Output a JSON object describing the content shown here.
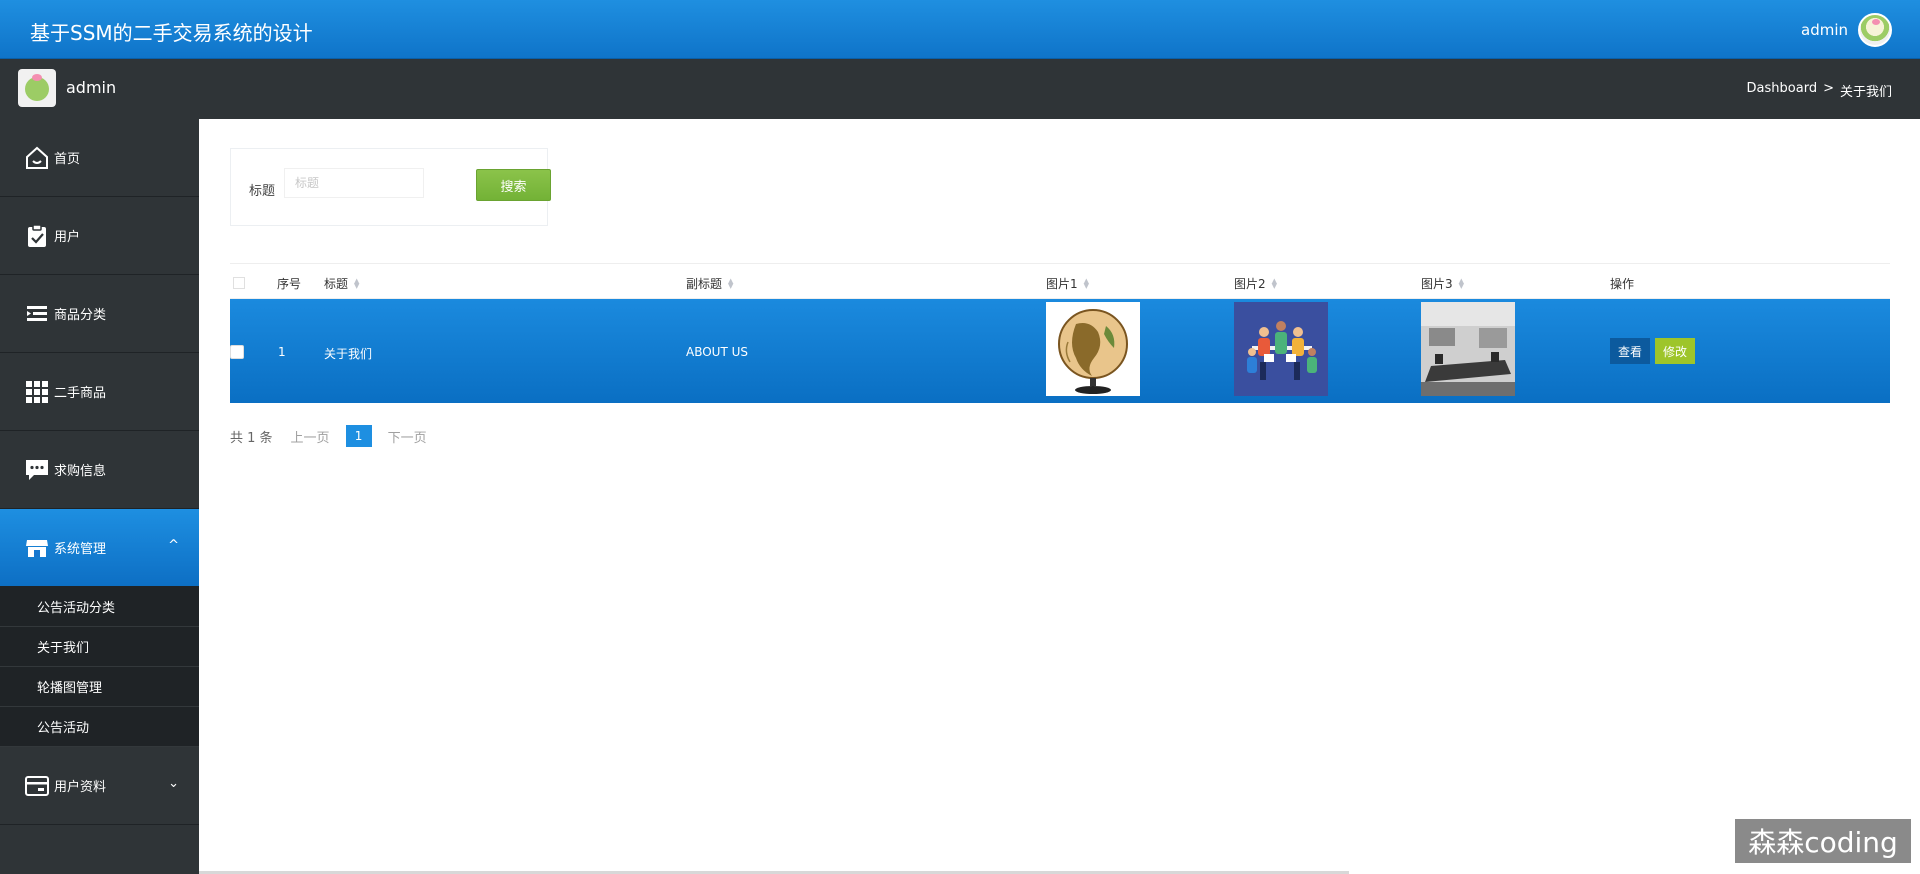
{
  "header": {
    "app_title": "基于SSM的二手交易系统的设计",
    "user_name": "admin"
  },
  "subbar": {
    "admin_name": "admin",
    "breadcrumb": [
      "Dashboard",
      ">",
      "关于我们"
    ]
  },
  "sidebar": {
    "items": [
      {
        "label": "首页",
        "icon": "home-icon"
      },
      {
        "label": "用户",
        "icon": "clipboard-icon"
      },
      {
        "label": "商品分类",
        "icon": "list-icon"
      },
      {
        "label": "二手商品",
        "icon": "grid-icon"
      },
      {
        "label": "求购信息",
        "icon": "chat-icon"
      },
      {
        "label": "系统管理",
        "icon": "store-icon",
        "expanded": true,
        "chevron": "^"
      },
      {
        "label": "用户资料",
        "icon": "card-icon",
        "chevron": "⌄"
      }
    ],
    "sub_items": [
      "公告活动分类",
      "关于我们",
      "轮播图管理",
      "公告活动"
    ]
  },
  "search": {
    "label": "标题",
    "placeholder": "标题",
    "button_label": "搜索"
  },
  "table": {
    "columns": [
      "序号",
      "标题",
      "副标题",
      "图片1",
      "图片2",
      "图片3",
      "操作"
    ],
    "rows": [
      {
        "index": "1",
        "title": "关于我们",
        "subtitle": "ABOUT US",
        "images": [
          "globe-image",
          "team-image",
          "meeting-room-image"
        ],
        "actions": [
          "查看",
          "修改"
        ]
      }
    ]
  },
  "pagination": {
    "total": "共 1 条",
    "prev": "上一页",
    "current": "1",
    "next": "下一页"
  },
  "watermark": "森森coding",
  "colors": {
    "topbar": "#1478d4",
    "sidebar": "#2f3437",
    "active": "#1e8fe1",
    "search_button": "#8bc34a",
    "edit_button": "#9ec52a",
    "view_button": "#0c5a9e"
  }
}
